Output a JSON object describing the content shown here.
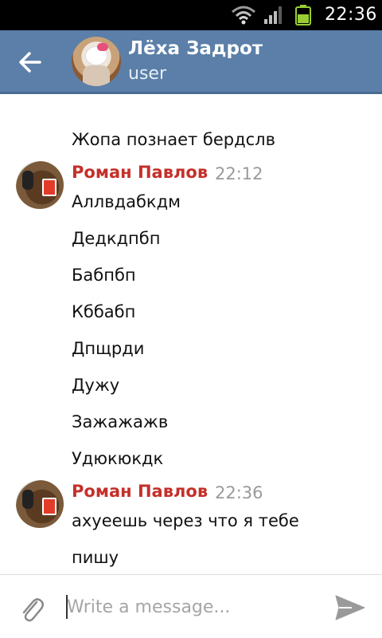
{
  "status_bar": {
    "time": "22:36"
  },
  "header": {
    "title": "Лёха Задрот",
    "subtitle": "user"
  },
  "messages": {
    "orphan_line": "Жопа познает бердслв",
    "groups": [
      {
        "sender": "Роман Павлов",
        "time": "22:12",
        "lines": [
          "Аллвдабкдм",
          "Дедкдпбп",
          "Бабпбп",
          "Кббабп",
          "Дпщрди",
          "Дужу",
          "Зажажажв",
          "Удюкюкдк"
        ]
      },
      {
        "sender": "Роман Павлов",
        "time": "22:36",
        "lines": [
          "ахуеешь через что я тебе",
          "пишу"
        ]
      }
    ]
  },
  "input": {
    "placeholder": "Write a message..."
  },
  "colors": {
    "header_bg": "#5b7fa8",
    "sender_name": "#c4302b",
    "timestamp": "#9a9a9a"
  }
}
